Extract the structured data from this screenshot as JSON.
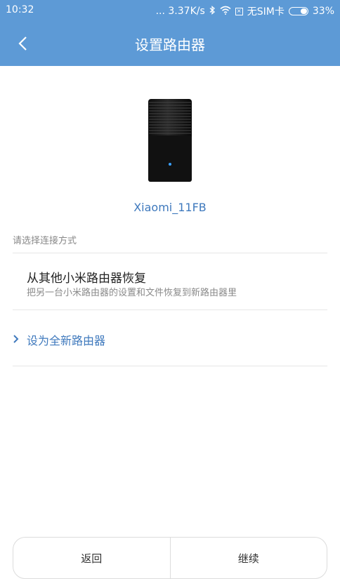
{
  "status_bar": {
    "time": "10:32",
    "speed": "... 3.37K/s",
    "sim": "无SIM卡",
    "battery": "33%"
  },
  "header": {
    "title": "设置路由器",
    "back_icon": "chevron-left-icon",
    "color": "#5d9ad6"
  },
  "device": {
    "name": "Xiaomi_11FB"
  },
  "section_label": "请选择连接方式",
  "options": {
    "restore": {
      "title": "从其他小米路由器恢复",
      "description": "把另一台小米路由器的设置和文件恢复到新路由器里"
    },
    "new_router": {
      "label": "设为全新路由器"
    }
  },
  "buttons": {
    "back": "返回",
    "continue": "继续"
  },
  "colors": {
    "accent": "#3f79bd"
  }
}
